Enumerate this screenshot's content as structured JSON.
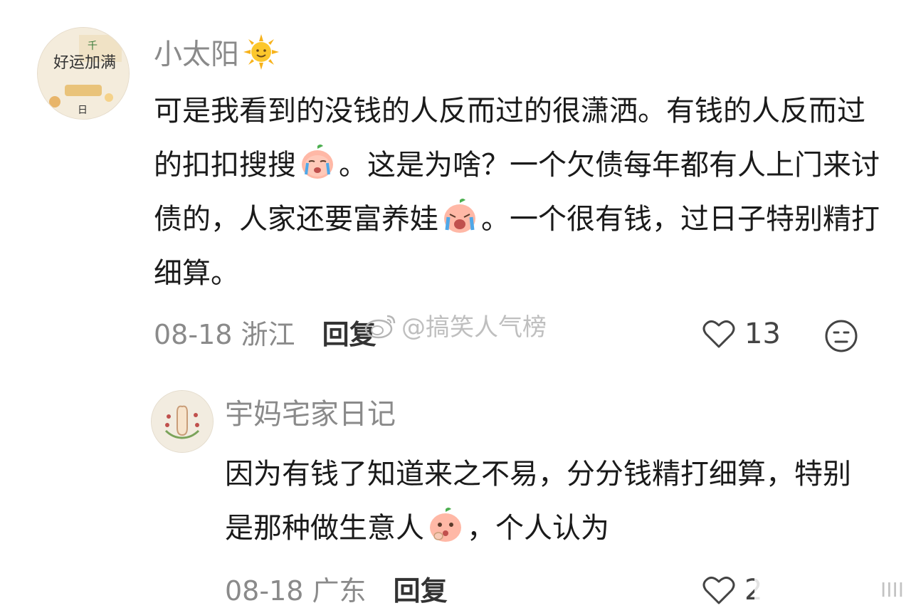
{
  "comment": {
    "username": "小太阳",
    "text_1": "可是我看到的没钱的人反而过的很潇洒。有钱的人反而过的扣扣搜搜",
    "text_2": "。这是为啥？一个欠债每年都有人上门来讨债的，人家还要富养娃",
    "text_3": "。一个很有钱，过日子特别精打细算。",
    "date": "08-18",
    "location": "浙江",
    "reply_label": "回复",
    "likes": "13",
    "avatar_text": "好运加满"
  },
  "reply": {
    "username": "宇妈宅家日记",
    "text_1": "因为有钱了知道来之不易，分分钱精打细算，特别是那种做生意人",
    "text_2": "，个人认为",
    "date": "08-18",
    "location": "广东",
    "reply_label": "回复",
    "likes": "2"
  },
  "watermark": {
    "center_text": "@搞笑人气榜",
    "corner_text": "IIII"
  },
  "colors": {
    "username": "#8a8a8a",
    "text": "#1a1a1a",
    "meta": "#8a8a8a"
  },
  "icons": [
    "sun-emoji-icon",
    "crying-peach-emoji-icon",
    "heart-outline-icon",
    "neutral-face-icon",
    "thinking-peach-emoji-icon",
    "weibo-logo-icon"
  ]
}
